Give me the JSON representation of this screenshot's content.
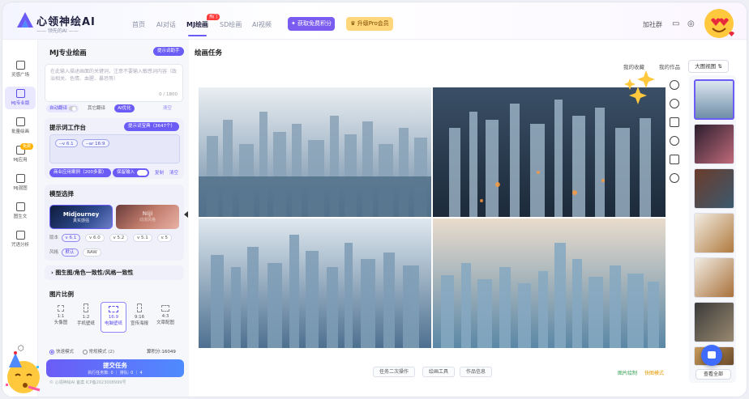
{
  "app": {
    "brand": "心领神绘AI",
    "slogan": "—— 领先的AI ——"
  },
  "nav": [
    {
      "label": "首页"
    },
    {
      "label": "AI对话"
    },
    {
      "label": "MJ绘画",
      "badge": "热门",
      "active": true
    },
    {
      "label": "SD绘画"
    },
    {
      "label": "AI视频"
    }
  ],
  "promo": {
    "free_points": "获取免费积分",
    "upgrade": "升级Pro会员"
  },
  "topright": {
    "group": "加社群"
  },
  "sidebar": [
    {
      "label": "灵感广场",
      "icon": "gallery-icon"
    },
    {
      "label": "MJ专业版",
      "icon": "palette-icon",
      "active": true
    },
    {
      "label": "批量绘画",
      "icon": "batch-icon"
    },
    {
      "label": "MJ应用",
      "icon": "apps-icon",
      "badge": "免费"
    },
    {
      "label": "MJ混图",
      "icon": "blend-icon"
    },
    {
      "label": "图生文",
      "icon": "image-to-text-icon"
    },
    {
      "label": "咒语分析",
      "icon": "analysis-icon"
    }
  ],
  "panel": {
    "title": "MJ专业绘画",
    "help": "提示词助手",
    "prompt_placeholder": "在此输入描述画面的关键词，注意不要输入敏感词内容（政治相关、色情、血腥、暴恐等）",
    "char_count": "0 / 1800",
    "auto_translate": "自动翻译",
    "other_translate": "其它翻译",
    "ai_optimize": "AI优化",
    "clear": "清空",
    "workbench": {
      "title": "提示词工作台",
      "library": "提示词宝典（3647个）",
      "tags": [
        "--v 6.1",
        "--ar 16:9"
      ],
      "cases": "商业应用案例（200多套）",
      "keep_input": "保留输入",
      "copy": "复制",
      "clear": "清空"
    },
    "model": {
      "title": "模型选择",
      "items": [
        {
          "name": "Midjourney",
          "sub": "真实感强"
        },
        {
          "name": "Niji",
          "sub": "动漫风格"
        }
      ],
      "version_label": "版本",
      "versions": [
        "v 6.1",
        "v 6.0",
        "v 5.2",
        "v 5.1",
        "v 5"
      ],
      "style_label": "风格",
      "styles": [
        "默认",
        "RAW"
      ]
    },
    "consistency": "图生图/角色一致性/风格一致性",
    "ratio": {
      "title": "图片比例",
      "items": [
        {
          "ratio": "1:1",
          "label": "头像图"
        },
        {
          "ratio": "1:2",
          "label": "手机壁纸"
        },
        {
          "ratio": "16:9",
          "label": "电脑壁纸",
          "selected": true
        },
        {
          "ratio": "9:16",
          "label": "宣传海报"
        },
        {
          "ratio": "4:3",
          "label": "文章配图"
        }
      ]
    },
    "modes": {
      "fast": "快速模式",
      "normal": "常规模式 (2)",
      "points": "算积分:16049"
    },
    "submit": {
      "label": "提交任务",
      "queue": "执行任务数: 0 ｜ 排队: 0 ｜ 4"
    },
    "footer": "© 心领神绘AI 备案 ICP备2023008999号"
  },
  "main": {
    "title": "绘画任务",
    "tabs": [
      "我的收藏",
      "我的作品"
    ],
    "big_view": "大图视图",
    "bottom_buttons": [
      "任务二次操作",
      "绘画工具",
      "作品信息"
    ],
    "download_links": [
      "图片绘制",
      "快图模式"
    ],
    "view_all": "查看全部"
  },
  "colors": {
    "accent": "#6b5cf6",
    "accent2": "#4f8bff",
    "promo_purple": "#7b5cf0",
    "promo_orange": "#ffc75a"
  }
}
